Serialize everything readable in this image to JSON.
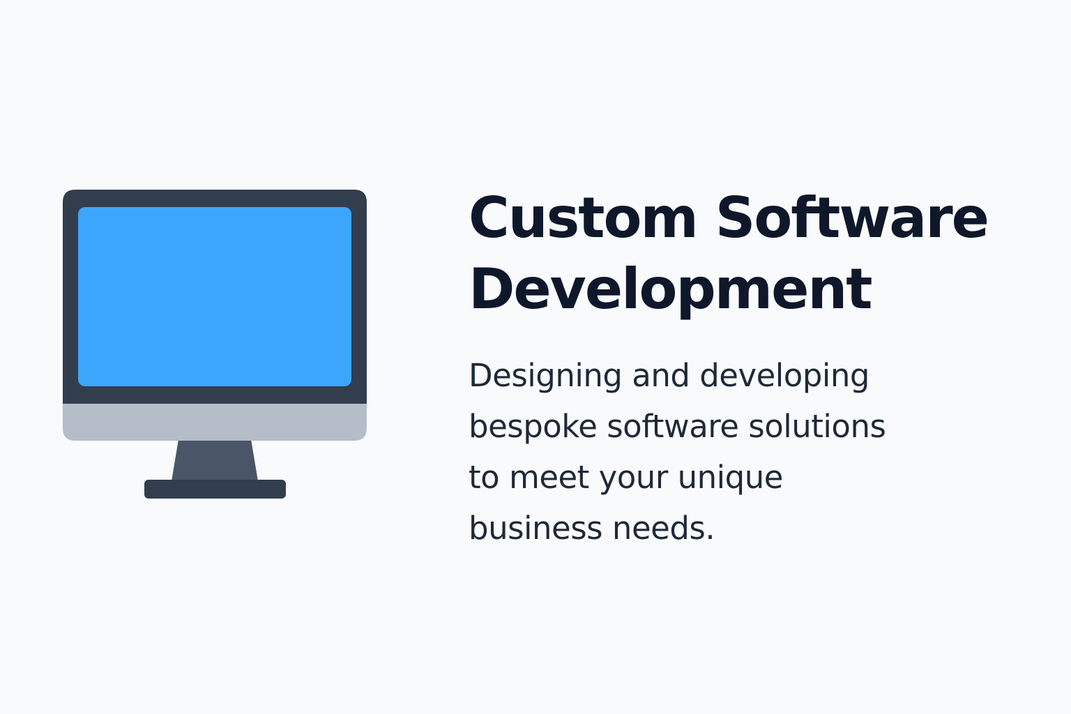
{
  "card": {
    "icon": "desktop-monitor-icon",
    "title": "Custom Software\nDevelopment",
    "description": "Designing and developing\nbespoke software solutions\nto meet your unique\nbusiness needs."
  },
  "colors": {
    "background": "#f8fafc",
    "screen": "#3ca6fd",
    "bezel": "#323d4e",
    "chin": "#b4bdc8",
    "stand": "#4a5568",
    "title_text": "#0f172a",
    "body_text": "#1f2937"
  }
}
